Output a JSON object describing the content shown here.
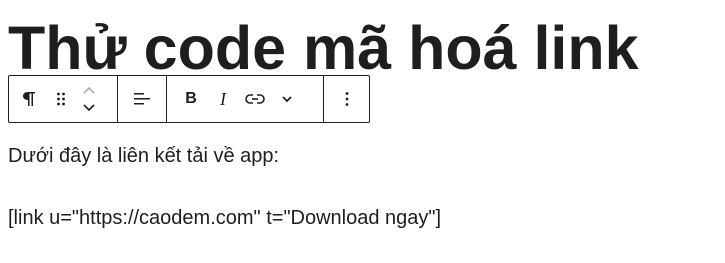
{
  "post": {
    "title": "Thử code mã hoá link",
    "paragraphs": [
      "Dưới đây là liên kết tải về app:",
      "[link u=\"https://caodem.com\" t=\"Download ngay\"]"
    ]
  },
  "toolbar": {
    "icons": [
      "paragraph-icon",
      "drag-handle-icon",
      "chevron-up-icon",
      "chevron-down-icon",
      "align-left-icon",
      "bold-icon",
      "italic-icon",
      "link-icon",
      "more-chevron-down-icon",
      "more-vertical-icon"
    ],
    "bold_glyph": "B",
    "italic_glyph": "I"
  },
  "colors": {
    "text": "#1e1e1e",
    "border": "#1e1e1e",
    "background": "#ffffff"
  }
}
